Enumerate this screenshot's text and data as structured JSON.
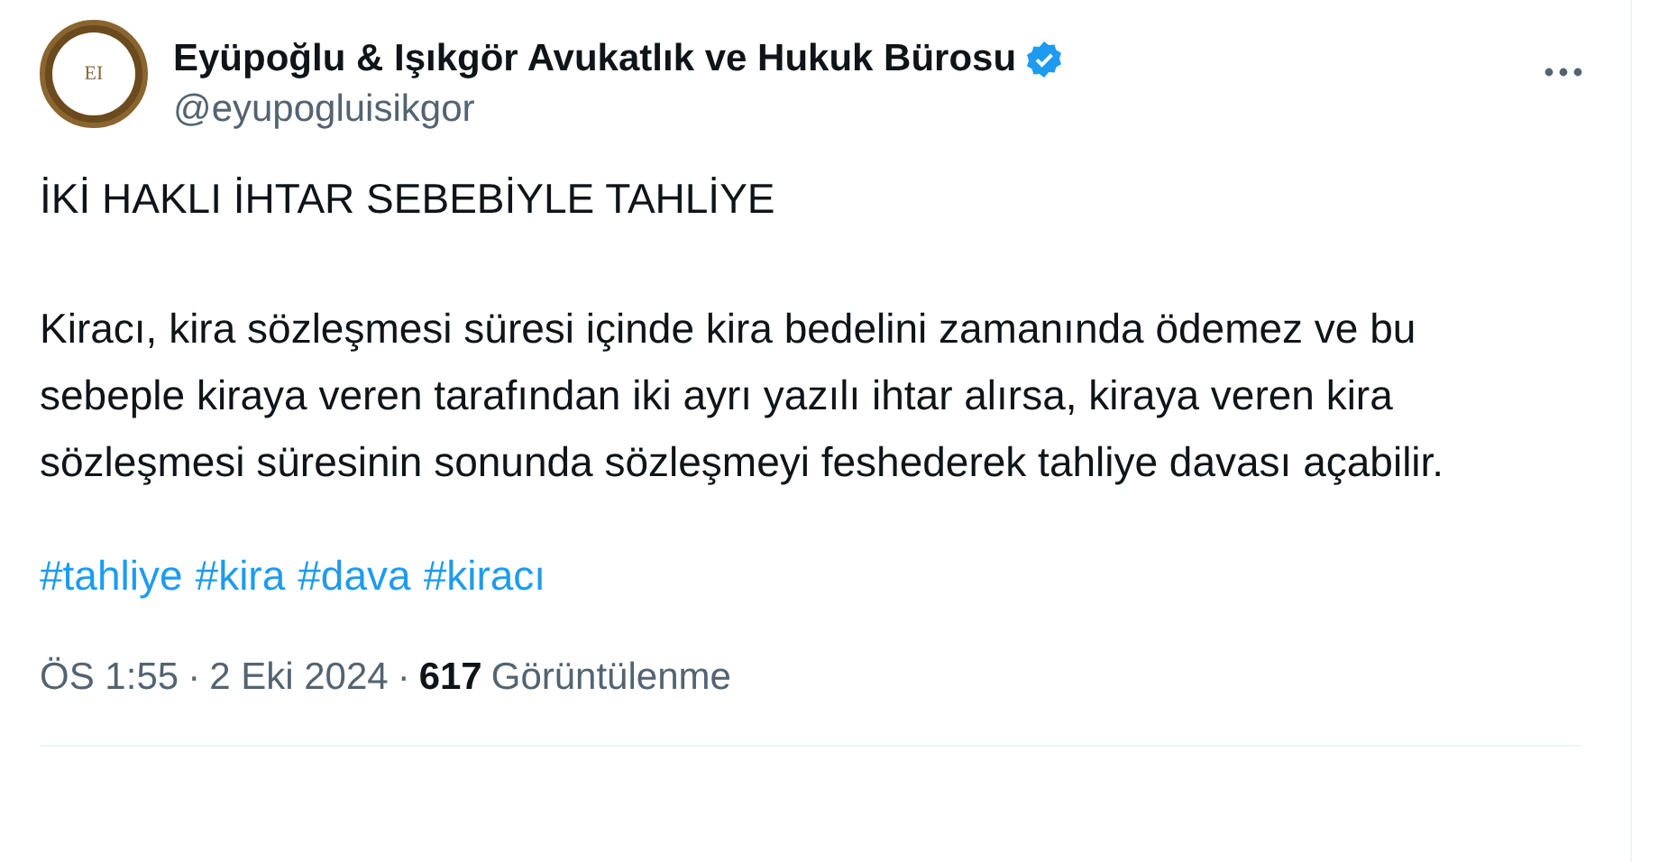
{
  "author": {
    "name": "Eyüpoğlu & Işıkgör Avukatlık ve Hukuk Bürosu",
    "verified": true,
    "handle": "@eyupogluisikgor",
    "avatar_text": "EI"
  },
  "post": {
    "title": "İKİ HAKLI İHTAR SEBEBİYLE TAHLİYE",
    "body": "Kiracı, kira sözleşmesi süresi içinde kira bedelini zamanında ödemez ve bu sebeple kiraya veren tarafından iki ayrı yazılı ihtar alırsa, kiraya veren kira sözleşmesi süresinin sonunda sözleşmeyi feshederek tahliye davası açabilir.",
    "hashtags": [
      "#tahliye",
      "#kira",
      "#dava",
      "#kiracı"
    ]
  },
  "meta": {
    "time": "ÖS 1:55",
    "separator": "·",
    "date": "2 Eki 2024",
    "views": "617",
    "views_label": "Görüntülenme"
  }
}
